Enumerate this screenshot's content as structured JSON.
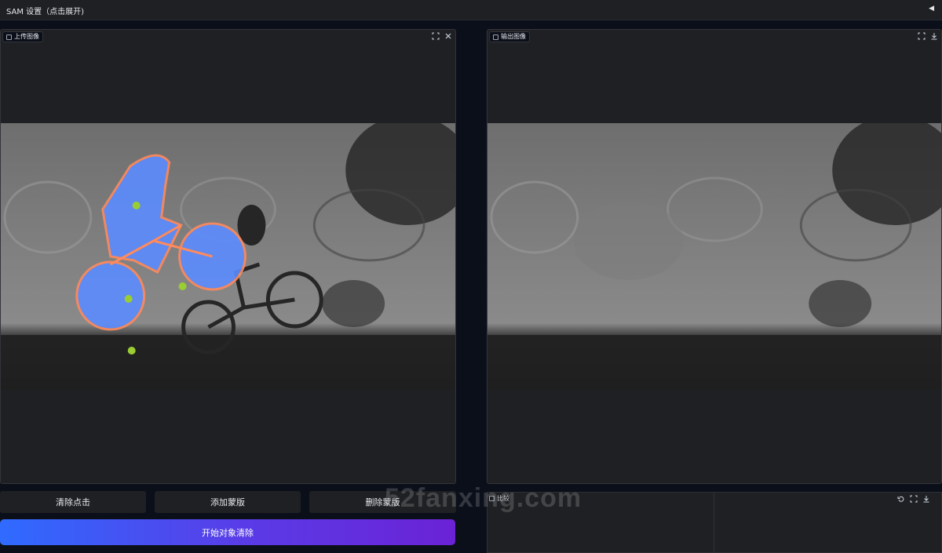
{
  "header": {
    "title": "SAM 设置（点击展开)",
    "toggle_icon": "◀"
  },
  "input_panel": {
    "label": "上传图像",
    "tools": [
      "fullscreen-icon",
      "close-icon"
    ]
  },
  "output_panel": {
    "label": "输出图像",
    "tools": [
      "fullscreen-icon",
      "download-icon"
    ]
  },
  "actions": {
    "clear_clicks": "清除点击",
    "add_mask": "添加蒙版",
    "delete_mask": "删除蒙版",
    "start_removal": "开始对象清除"
  },
  "compare_panel": {
    "label": "比较",
    "tools": [
      "undo-icon",
      "fullscreen-icon",
      "download-icon"
    ]
  },
  "watermark": "52fanxing.com",
  "colors": {
    "accent_start": "#2f6bff",
    "accent_end": "#6b22d6",
    "mask_fill": "#5b8cff",
    "mask_outline": "#ff8a5c",
    "click_point": "#9acd32",
    "panel_bg": "#1f2023",
    "page_bg": "#0b0f19"
  }
}
